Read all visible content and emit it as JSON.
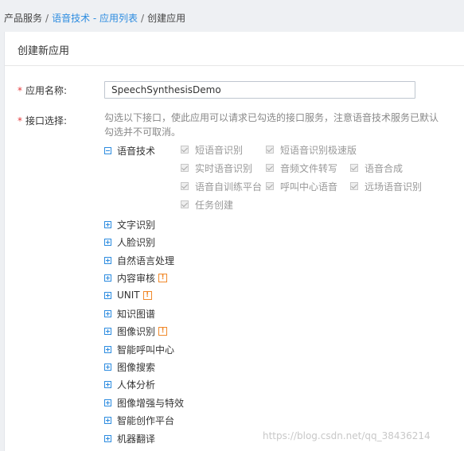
{
  "breadcrumb": {
    "item1": "产品服务",
    "sep": "/",
    "item2": "语音技术 - 应用列表",
    "item3": "创建应用"
  },
  "panel": {
    "title": "创建新应用"
  },
  "form": {
    "app_name_label": "应用名称:",
    "app_name_value": "SpeechSynthesisDemo",
    "interface_label": "接口选择:",
    "required_mark": "*",
    "hint": "勾选以下接口，使此应用可以请求已勾选的接口服务，注意语音技术服务已默认勾选并不可取消。"
  },
  "speech_group": {
    "label": "语音技术",
    "expanded": true,
    "items": [
      {
        "label": "短语音识别",
        "checked": true,
        "disabled": true
      },
      {
        "label": "短语音识别极速版",
        "checked": true,
        "disabled": true
      },
      {
        "label": "实时语音识别",
        "checked": true,
        "disabled": true
      },
      {
        "label": "音频文件转写",
        "checked": true,
        "disabled": true
      },
      {
        "label": "语音合成",
        "checked": true,
        "disabled": true
      },
      {
        "label": "语音自训练平台",
        "checked": true,
        "disabled": true
      },
      {
        "label": "呼叫中心语音",
        "checked": true,
        "disabled": true
      },
      {
        "label": "远场语音识别",
        "checked": true,
        "disabled": true
      },
      {
        "label": "任务创建",
        "checked": true,
        "disabled": true
      }
    ]
  },
  "groups": [
    {
      "label": "文字识别",
      "warn": false
    },
    {
      "label": "人脸识别",
      "warn": false
    },
    {
      "label": "自然语言处理",
      "warn": false
    },
    {
      "label": "内容审核",
      "warn": true
    },
    {
      "label": "UNIT",
      "warn": true
    },
    {
      "label": "知识图谱",
      "warn": false
    },
    {
      "label": "图像识别",
      "warn": true
    },
    {
      "label": "智能呼叫中心",
      "warn": false
    },
    {
      "label": "图像搜索",
      "warn": false
    },
    {
      "label": "人体分析",
      "warn": false
    },
    {
      "label": "图像增强与特效",
      "warn": false
    },
    {
      "label": "智能创作平台",
      "warn": false
    },
    {
      "label": "机器翻译",
      "warn": false
    }
  ],
  "warn_symbol": "!",
  "watermark": "https://blog.csdn.net/qq_38436214",
  "colors": {
    "link": "#2d8ce0",
    "required": "#e4393c",
    "warning": "#f0892b",
    "toggle": "#2d8ce0"
  }
}
